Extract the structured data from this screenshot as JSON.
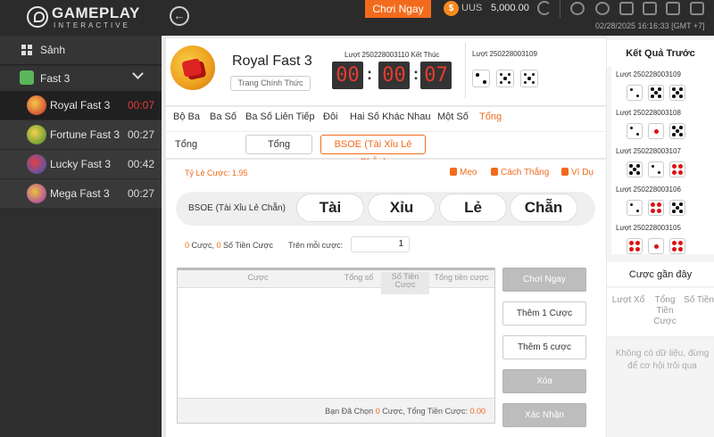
{
  "brand": {
    "name": "GAMEPLAY",
    "tagline": "INTERACTIVE"
  },
  "topbar": {
    "play_now": "Chơi Ngay",
    "currency": "UUS",
    "balance": "5,000.00",
    "datetime": "02/28/2025 16:16:33 [GMT +7]"
  },
  "sidebar": {
    "lobby": "Sảnh",
    "group": "Fast 3",
    "items": [
      {
        "label": "Royal Fast 3",
        "time": "00:07",
        "color": "#c8282d"
      },
      {
        "label": "Fortune Fast 3",
        "time": "00:27",
        "color": "#e2a12a"
      },
      {
        "label": "Lucky Fast 3",
        "time": "00:42",
        "color": "#3a63c9"
      },
      {
        "label": "Mega Fast 3",
        "time": "00:27",
        "color": "#9c2dbb"
      }
    ]
  },
  "game": {
    "title": "Royal Fast 3",
    "official_link": "Trang Chính Thức",
    "current_round_label": "Lượt 250228003110 Kết Thúc",
    "timer": {
      "h": "00",
      "m": "00",
      "s": "07"
    },
    "prev_round_label": "Lượt 250228003109",
    "prev_dice": [
      2,
      5,
      5
    ]
  },
  "tabs": [
    "Bộ Ba",
    "Ba Số",
    "Ba Số Liên Tiếp",
    "Đôi",
    "Hai Số Khác Nhau",
    "Một Số",
    "Tổng"
  ],
  "subtabs": {
    "label": "Tổng",
    "buttons": [
      "Tổng",
      "BSOE (Tài Xỉu Lẻ Chẵn)"
    ]
  },
  "bet": {
    "ratio": "Tỷ Lệ Cược: 1.95",
    "hints": [
      "Mẹo",
      "Cách Thắng",
      "Ví Dụ"
    ],
    "options_label": "BSOE (Tài Xỉu Lẻ Chẵn)",
    "options": [
      "Tài",
      "Xỉu",
      "Lẻ",
      "Chẵn"
    ],
    "count_zero": "0",
    "count_text": "Cược,",
    "amount_zero": "0",
    "amount_text": "Số Tiền Cược",
    "per_bet_label": "Trên mỗi cược:",
    "per_bet_value": "1",
    "table_headers": [
      "Cược",
      "Tổng số",
      "Số Tiền Cược",
      "Tổng tiền cược"
    ],
    "footer_prefix": "Bạn Đã Chọn",
    "footer_count": "0",
    "footer_mid": "Cược, Tổng Tiền Cược:",
    "footer_amount": "0.00",
    "actions": [
      "Chơi Ngay",
      "Thêm 1 Cược",
      "Thêm 5 cược",
      "Xóa",
      "Xác Nhận"
    ]
  },
  "results": {
    "title": "Kết Quả Trước",
    "rows": [
      {
        "label": "Lượt 250228003109",
        "dice": [
          2,
          5,
          5
        ]
      },
      {
        "label": "Lượt 250228003108",
        "dice": [
          2,
          1,
          5
        ]
      },
      {
        "label": "Lượt 250228003107",
        "dice": [
          5,
          2,
          4
        ]
      },
      {
        "label": "Lượt 250228003106",
        "dice": [
          2,
          4,
          5
        ]
      },
      {
        "label": "Lượt 250228003105",
        "dice": [
          4,
          1,
          4
        ]
      }
    ]
  },
  "recent": {
    "title": "Cược gần đây",
    "headers": [
      "Lượt Xổ",
      "Tổng Tiền Cược",
      "Số Tiền"
    ],
    "empty": "Không có dữ liệu, đừng để cơ hội trôi qua"
  },
  "colors": {
    "accent": "#f26b1d",
    "timer_digits": "#e53d2f"
  }
}
